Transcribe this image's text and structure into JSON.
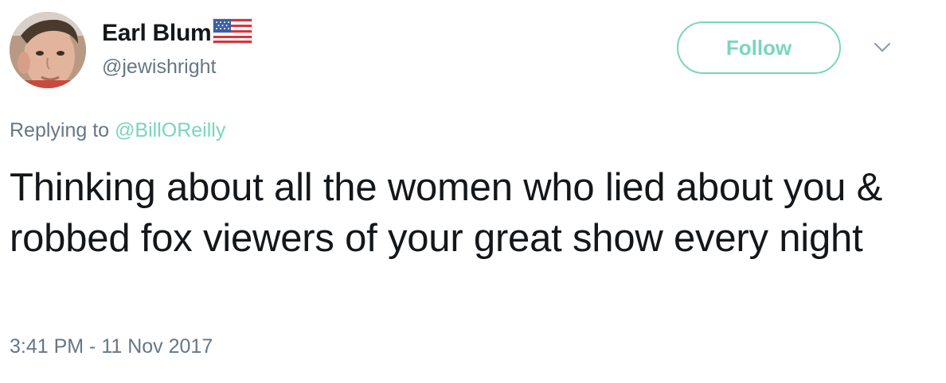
{
  "author": {
    "display_name": "Earl Blum",
    "handle": "@jewishright",
    "avatar_icon": "avatar-photo",
    "badge_icon": "us-flag-emoji"
  },
  "follow_button": {
    "label": "Follow",
    "accent_color": "#79d6bd"
  },
  "menu_icon": "chevron-down-icon",
  "reply": {
    "prefix": "Replying to",
    "mention": "@BillOReilly"
  },
  "tweet": {
    "text": "Thinking about all the women who lied about you & robbed fox viewers of your great show every night",
    "timestamp": "3:41 PM - 11 Nov 2017"
  },
  "colors": {
    "text_primary": "#14171a",
    "text_secondary": "#657786",
    "accent": "#79d6bd"
  }
}
